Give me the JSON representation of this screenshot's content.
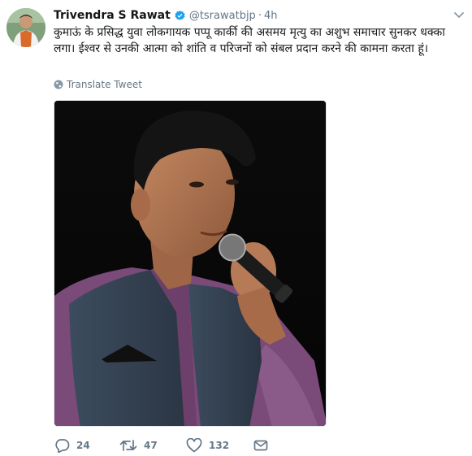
{
  "tweet": {
    "author_name": "Trivendra S Rawat",
    "handle": "@tsrawatbjp",
    "separator": "·",
    "time": "4h",
    "text": "कुमाऊं के प्रसिद्ध युवा लोकगायक पप्पू कार्की की असमय मृत्यु का अशुभ समाचार सुनकर धक्का लगा। ईश्वर से उनकी आत्मा को शांति व परिजनों को संबल प्रदान करने की कामना करता हूं।",
    "translate_label": "Translate Tweet"
  },
  "actions": {
    "replies": "24",
    "retweets": "47",
    "likes": "132"
  },
  "colors": {
    "verified": "#1da1f2",
    "meta": "#657786",
    "text": "#14171a"
  },
  "icons": {
    "verified": "verified-badge-icon",
    "caret": "chevron-down-icon",
    "translate": "globe-icon",
    "reply": "reply-icon",
    "retweet": "retweet-icon",
    "like": "heart-icon",
    "dm": "envelope-icon"
  }
}
